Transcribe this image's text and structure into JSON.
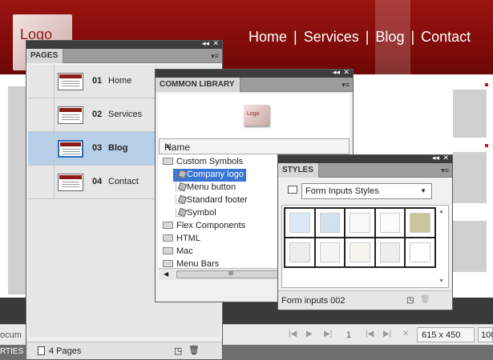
{
  "site": {
    "logo_text": "Logo",
    "nav": [
      "Home",
      "Services",
      "Blog",
      "Contact"
    ],
    "nav_separator": "|",
    "brand_color": "#8c1b18"
  },
  "status": {
    "doc_fragment": "ocum",
    "page_number": "1",
    "dimensions": "615 x 450",
    "zoom_fragment": "100",
    "props_tab_fragment": "RTIES"
  },
  "pages_panel": {
    "title": "PAGES",
    "items": [
      {
        "num": "01",
        "name": "Home"
      },
      {
        "num": "02",
        "name": "Services"
      },
      {
        "num": "03",
        "name": "Blog"
      },
      {
        "num": "04",
        "name": "Contact"
      }
    ],
    "selected_index": 2,
    "footer_count": "4 Pages"
  },
  "library_panel": {
    "title": "COMMON LIBRARY",
    "preview_label": "Logo",
    "column_header": "Name",
    "tree": [
      {
        "label": "Custom Symbols",
        "kind": "folder",
        "level": 0
      },
      {
        "label": "Company logo",
        "kind": "symbol",
        "level": 1,
        "selected": true
      },
      {
        "label": "Menu button",
        "kind": "symbol",
        "level": 1
      },
      {
        "label": "Standard footer",
        "kind": "symbol",
        "level": 1
      },
      {
        "label": "Symbol",
        "kind": "symbol",
        "level": 1
      },
      {
        "label": "Flex Components",
        "kind": "folder",
        "level": 0
      },
      {
        "label": "HTML",
        "kind": "folder",
        "level": 0
      },
      {
        "label": "Mac",
        "kind": "folder",
        "level": 0
      },
      {
        "label": "Menu Bars",
        "kind": "folder",
        "level": 0
      }
    ],
    "scroll_grip": "III"
  },
  "styles_panel": {
    "title": "STYLES",
    "selected_style_set": "Form Inputs Styles",
    "swatch_colors": [
      "#dce8f8",
      "#d3e0f0",
      "#f8f8f8",
      "#fbfbfb",
      "#c9c69a",
      "#ececec",
      "#f5f5f5",
      "#f7f6ee",
      "#eeeeee",
      "#ffffff"
    ],
    "footer_label": "Form inputs 002"
  }
}
